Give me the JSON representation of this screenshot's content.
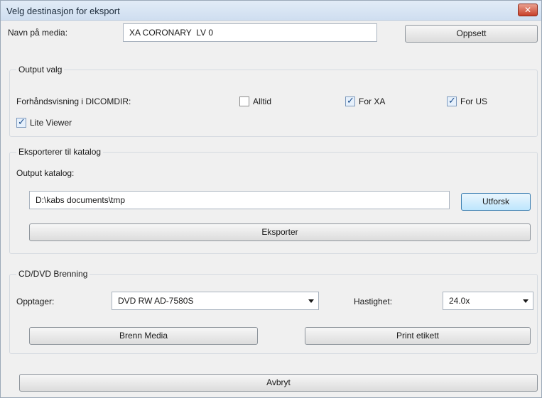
{
  "window": {
    "title": "Velg destinasjon for eksport",
    "close_glyph": "✕"
  },
  "media": {
    "label": "Navn på media:",
    "value": "XA CORONARY  LV 0",
    "setup_button": "Oppsett"
  },
  "output_options": {
    "group_title": "Output valg",
    "preview_label": "Forhåndsvisning i DICOMDIR:",
    "checkboxes": [
      {
        "label": "Alltid",
        "checked": false
      },
      {
        "label": "For XA",
        "checked": true
      },
      {
        "label": "For US",
        "checked": true
      },
      {
        "label": "Lite Viewer",
        "checked": true
      }
    ]
  },
  "export_folder": {
    "group_title": "Eksporterer til katalog",
    "output_label": "Output katalog:",
    "path_value": "D:\\kabs documents\\tmp",
    "browse_button": "Utforsk",
    "export_button": "Eksporter"
  },
  "burning": {
    "group_title": "CD/DVD Brenning",
    "recorder_label": "Opptager:",
    "recorder_value": "DVD RW AD-7580S",
    "speed_label": "Hastighet:",
    "speed_value": "24.0x",
    "burn_button": "Brenn Media",
    "print_button": "Print etikett"
  },
  "cancel_button": "Avbryt",
  "check_glyph": "✓"
}
